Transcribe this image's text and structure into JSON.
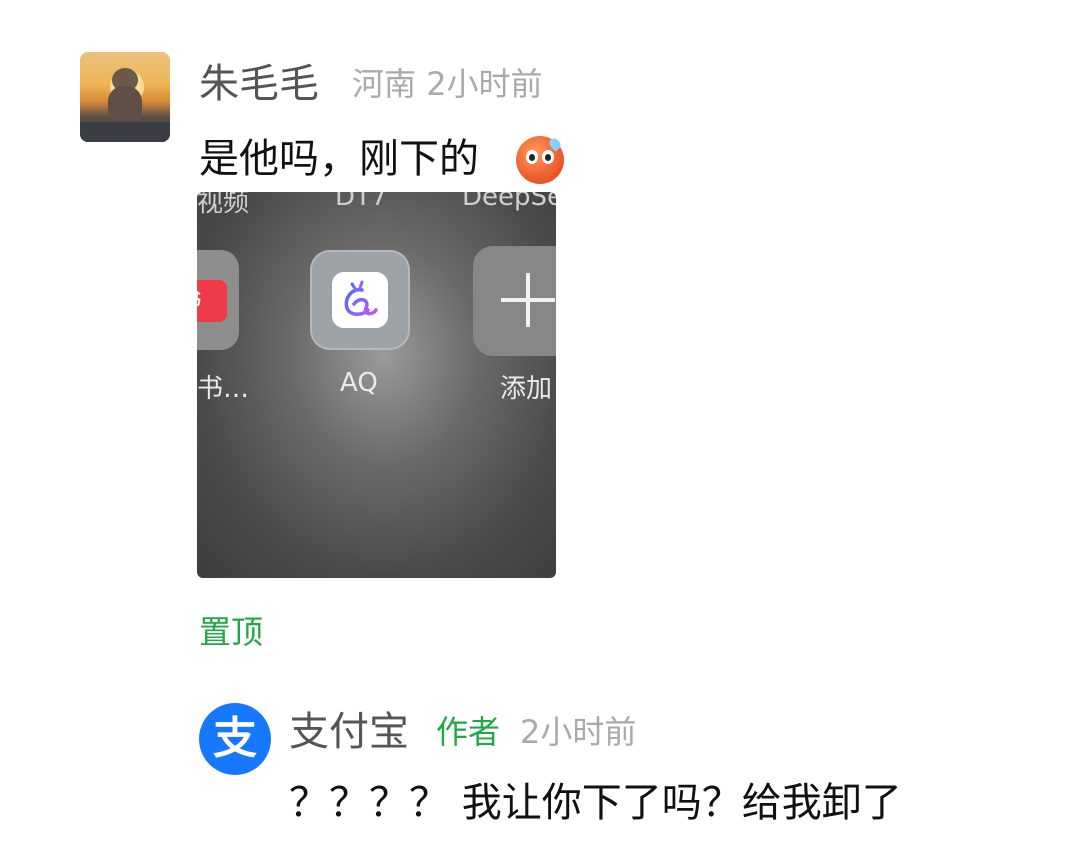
{
  "comment": {
    "username": "朱毛毛",
    "location": "河南",
    "time": "2小时前",
    "text": "是他吗，刚下的",
    "emoji_icon": "anxious-sweat-face-icon"
  },
  "screenshot": {
    "top_labels": [
      "视频",
      "DT7",
      "DeepSe"
    ],
    "apps": [
      {
        "label": "书…",
        "icon_text": "书",
        "icon": "red-book-app-icon"
      },
      {
        "label": "AQ",
        "icon": "aq-app-icon"
      },
      {
        "label": "添加",
        "icon": "plus-icon"
      }
    ]
  },
  "pin_label": "置顶",
  "reply": {
    "username": "支付宝",
    "avatar_text": "支",
    "author_tag": "作者",
    "time": "2小时前",
    "text": "？？？？ 我让你下了吗？给我卸了"
  },
  "colors": {
    "accent_green": "#20a845",
    "alipay_blue": "#1678ff"
  }
}
